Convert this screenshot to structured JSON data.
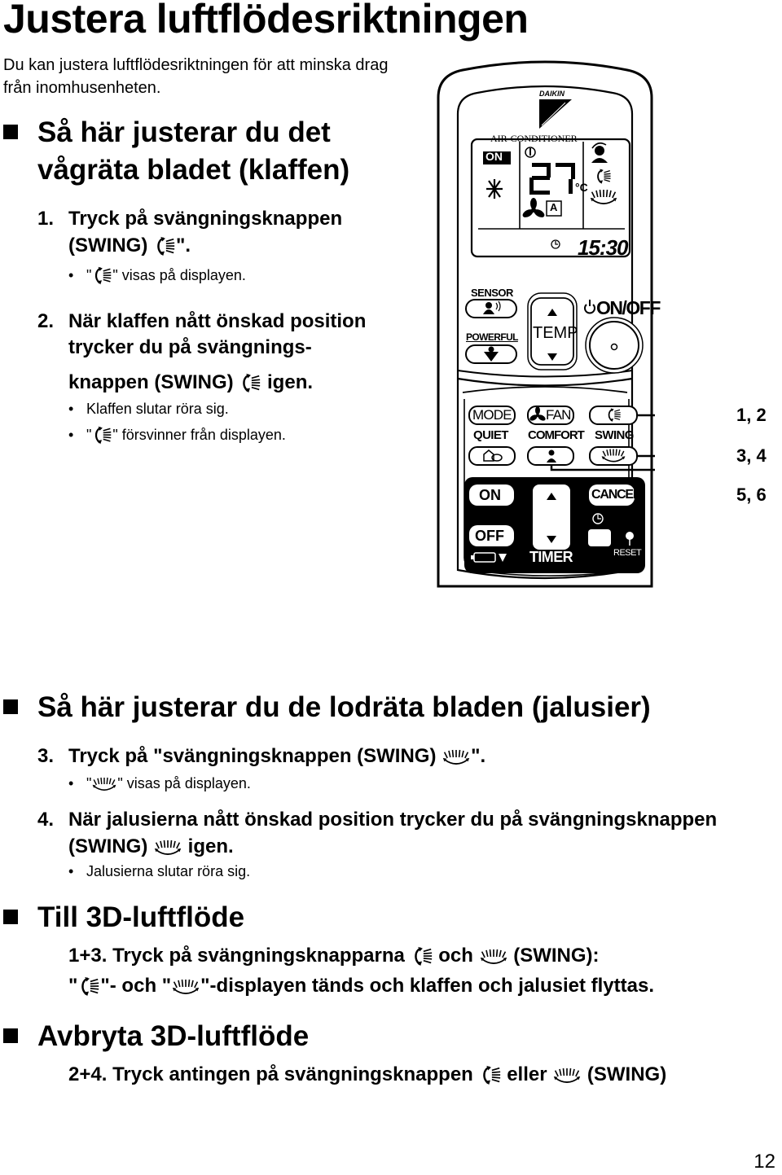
{
  "page": {
    "title": "Justera luftflödesriktningen",
    "intro": "Du kan justera luftflödesriktningen för att minska drag från inomhusenheten.",
    "page_number": "12"
  },
  "section1": {
    "title_line1": "Så här justerar du det",
    "title_line2": "vågräta bladet (klaffen)",
    "steps": [
      {
        "num": "1.",
        "line1": "Tryck på svängningsknappen",
        "line2_prefix": "(SWING)",
        "line2_suffix": "\".",
        "icon": "flap-swing-icon",
        "bullets": [
          {
            "prefix": "\"",
            "icon": "flap-swing-icon",
            "suffix": "\" visas på displayen."
          }
        ]
      },
      {
        "num": "2.",
        "line1": "När klaffen nått önskad position",
        "line2": "trycker du på svängnings-",
        "line3_prefix": "knappen (SWING)",
        "line3_suffix": "igen.",
        "icon": "flap-swing-icon",
        "bullets": [
          {
            "text": "Klaffen slutar röra sig."
          },
          {
            "prefix": "\"",
            "icon": "flap-swing-icon",
            "suffix": "\" försvinner från displayen."
          }
        ]
      }
    ]
  },
  "remote": {
    "brand": "DAIKIN",
    "subtitle": "AIR-CONDITIONER",
    "display": {
      "on_label": "ON",
      "temperature": "27",
      "unit": "°C",
      "fan_mode": "A",
      "time": "15:30",
      "icons": [
        "snowflake-icon",
        "thermometer-icon",
        "fan-icon",
        "comfort-icon",
        "flap-swing-icon",
        "louver-swing-icon",
        "clock-icon"
      ]
    },
    "buttons": {
      "sensor": "SENSOR",
      "powerful": "POWERFUL",
      "temp": "TEMP",
      "on_off": "ON/OFF",
      "mode": "MODE",
      "fan": "FAN",
      "quiet": "QUIET",
      "comfort": "COMFORT",
      "swing": "SWING",
      "timer_on": "ON",
      "timer_off": "OFF",
      "cancel": "CANCEL",
      "timer": "TIMER",
      "reset": "RESET"
    },
    "callouts": [
      "1, 2",
      "3, 4",
      "5, 6"
    ]
  },
  "section2": {
    "title": "Så här justerar du de lodräta bladen (jalusier)",
    "steps": [
      {
        "num": "3.",
        "prefix": "Tryck på \"svängningsknappen (SWING)",
        "suffix": "\".",
        "icon": "louver-swing-icon",
        "bullets": [
          {
            "prefix": "\"",
            "icon": "louver-swing-icon",
            "suffix": "\" visas på displayen."
          }
        ]
      },
      {
        "num": "4.",
        "line1": "När jalusierna nått önskad position trycker du på svängningsknappen",
        "line2_prefix": "(SWING)",
        "line2_suffix": "igen.",
        "icon": "louver-swing-icon",
        "bullets": [
          {
            "text": "Jalusierna slutar röra sig."
          }
        ]
      }
    ]
  },
  "section3": {
    "title": "Till 3D-luftflöde",
    "num": "1+3.",
    "line1_a": "Tryck på svängningsknapparna",
    "line1_b": "och",
    "line1_c": "(SWING):",
    "line2_a": "\"",
    "line2_b": "\"- och \"",
    "line2_c": "\"-displayen tänds och klaffen och jalusiet flyttas."
  },
  "section4": {
    "title": "Avbryta 3D-luftflöde",
    "num": "2+4.",
    "line1_a": "Tryck antingen på svängningsknappen",
    "line1_b": "eller",
    "line1_c": "(SWING)"
  }
}
